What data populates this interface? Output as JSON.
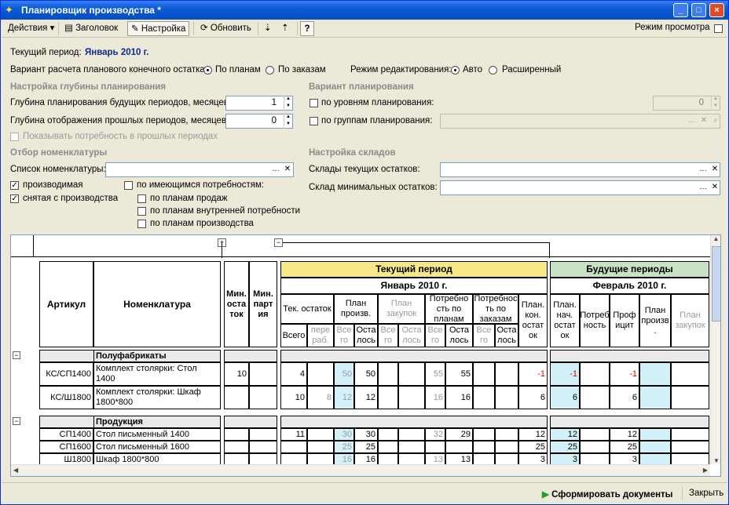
{
  "window": {
    "title": "Планировщик производства *"
  },
  "toolbar": {
    "actions": "Действия",
    "header": "Заголовок",
    "settings": "Настройка",
    "refresh": "Обновить",
    "help": "?",
    "view_mode": "Режим просмотра"
  },
  "form": {
    "current_period_label": "Текущий период:",
    "current_period_value": "Январь 2010 г.",
    "calc_variant_label": "Вариант расчета планового конечного остатка:",
    "by_plans": "По планам",
    "by_orders": "По заказам",
    "edit_mode_label": "Режим редактирования:",
    "auto": "Авто",
    "extended": "Расширенный",
    "depth_section": "Настройка глубины планирования",
    "future_depth_label": "Глубина планирования будущих периодов, месяцев:",
    "future_depth_value": "1",
    "past_depth_label": "Глубина отображения прошлых периодов, месяцев:",
    "past_depth_value": "0",
    "show_past_needs": "Показывать потребность в прошлых периодах",
    "variant_section": "Вариант планирования",
    "by_levels": "по уровням планирования:",
    "by_levels_value": "0",
    "by_groups": "по группам планирования:",
    "nomenclature_section": "Отбор номенклатуры",
    "nomenclature_list": "Список номенклатуры:",
    "produced": "производимая",
    "discontinued": "снятая с производства",
    "by_existing_needs": "по имеющимся потребностям:",
    "by_sales_plans": "по планам продаж",
    "by_internal_plans": "по планам внутренней потребности",
    "by_production_plans": "по планам производства",
    "warehouse_section": "Настройка складов",
    "current_stock_wh": "Склады текущих остатков:",
    "min_stock_wh": "Склад минимальных остатков:"
  },
  "grid": {
    "headers": {
      "article": "Артикул",
      "nomenclature": "Номенклатура",
      "min_stock": "Мин. оста ток",
      "min_batch": "Мин. парт ия",
      "current_period": "Текущий период",
      "current_month": "Январь 2010 г.",
      "future_periods": "Будущие периоды",
      "future_month": "Февраль 2010 г.",
      "cur_stock": "Тек. остаток",
      "plan_prod": "План произв.",
      "plan_purchase": "План закупок",
      "need_plans": "Потребно сть по планам",
      "need_orders": "Потребнос ть по заказам",
      "plan_end": "План. кон. остат ок",
      "plan_start": "План. нач. остат ок",
      "need": "Потреб ность",
      "profit": "Проф ицит",
      "f_plan_prod": "План произв .",
      "f_plan_purchase": "План закупок",
      "total": "Всего",
      "reproc": "пере раб.",
      "all": "Все го",
      "remaining": "Оста лось"
    },
    "groups": [
      {
        "name": "Полуфабрикаты",
        "rows": [
          {
            "article": "КС/СП1400",
            "name": "Комплект столярки: Стол 1400",
            "min_stock": "10",
            "cur_total": "4",
            "reproc": "",
            "pp_all": "50",
            "pp_rem": "50",
            "np_all": "55",
            "np_rem": "55",
            "end": "-1",
            "f_start": "-1",
            "f_need": "",
            "f_profit": "-1"
          },
          {
            "article": "КС/Ш1800",
            "name": "Комплект столярки: Шкаф 1800*800",
            "min_stock": "",
            "cur_total": "10",
            "reproc": "8",
            "pp_all": "12",
            "pp_rem": "12",
            "np_all": "16",
            "np_rem": "16",
            "end": "6",
            "f_start": "6",
            "f_need": "",
            "f_profit": "6"
          }
        ]
      },
      {
        "name": "Продукция",
        "rows": [
          {
            "article": "СП1400",
            "name": "Стол письменный 1400",
            "min_stock": "",
            "cur_total": "11",
            "reproc": "",
            "pp_all": "30",
            "pp_rem": "30",
            "np_all": "32",
            "np_rem": "29",
            "end": "12",
            "f_start": "12",
            "f_need": "",
            "f_profit": "12"
          },
          {
            "article": "СП1600",
            "name": "Стол письменный 1600",
            "min_stock": "",
            "cur_total": "",
            "reproc": "",
            "pp_all": "25",
            "pp_rem": "25",
            "np_all": "",
            "np_rem": "",
            "end": "25",
            "f_start": "25",
            "f_need": "",
            "f_profit": "25"
          },
          {
            "article": "Ш1800",
            "name": "Шкаф 1800*800",
            "min_stock": "",
            "cur_total": "",
            "reproc": "",
            "pp_all": "16",
            "pp_rem": "16",
            "np_all": "13",
            "np_rem": "13",
            "end": "3",
            "f_start": "3",
            "f_need": "",
            "f_profit": "3"
          }
        ]
      }
    ]
  },
  "status": {
    "generate_docs": "Сформировать документы",
    "close": "Закрыть"
  },
  "colors": {
    "current_header": "#f7e887",
    "future_header": "#c7e3c4",
    "highlight_cell": "#d3f1f8",
    "negative": "#e00000",
    "disabled_text": "#9a9a9a"
  }
}
